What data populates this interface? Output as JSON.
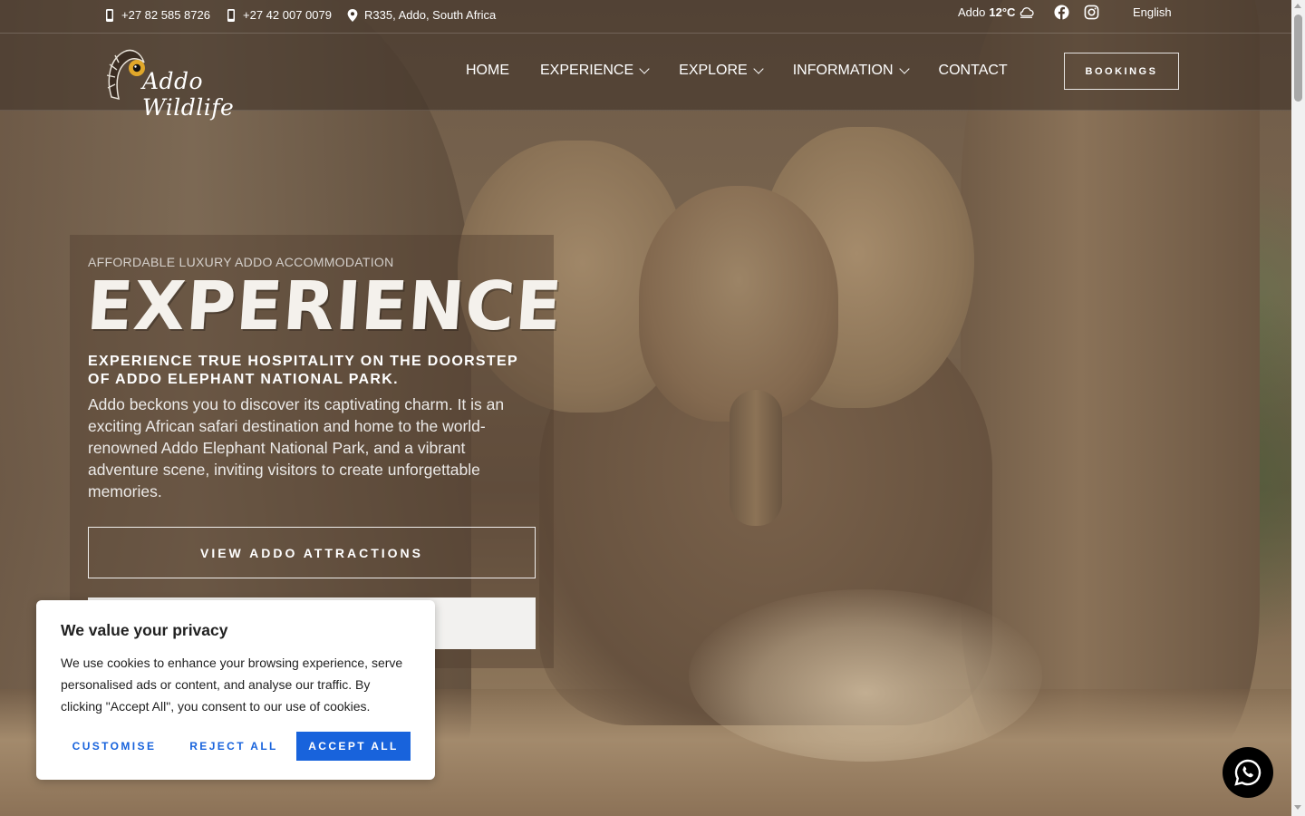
{
  "topbar": {
    "phone1": "+27 82 585 8726",
    "phone2": "+27 42 007 0079",
    "address": "R335, Addo, South Africa",
    "weather_place": "Addo",
    "weather_temp": "12°C",
    "language": "English"
  },
  "header": {
    "logo_text": "Addo Wildlife",
    "nav": {
      "home": "HOME",
      "experience": "EXPERIENCE",
      "explore": "EXPLORE",
      "information": "INFORMATION",
      "contact": "CONTACT"
    },
    "bookings": "BOOKINGS"
  },
  "hero": {
    "eyebrow": "AFFORDABLE LUXURY ADDO ACCOMMODATION",
    "title": "EXPERIENCE",
    "subtitle": "EXPERIENCE TRUE HOSPITALITY ON THE DOORSTEP OF ADDO ELEPHANT NATIONAL PARK.",
    "body": "Addo beckons you to discover its captivating charm. It is an exciting African safari destination and home to the world-renowned Addo Elephant National Park, and a vibrant adventure scene, inviting visitors to create unforgettable memories.",
    "button": "VIEW ADDO ATTRACTIONS"
  },
  "cookie": {
    "title": "We value your privacy",
    "text": "We use cookies to enhance your browsing experience, serve personalised ads or content, and analyse our traffic. By clicking \"Accept All\", you consent to our use of cookies.",
    "customise": "CUSTOMISE",
    "reject": "REJECT ALL",
    "accept": "ACCEPT ALL"
  },
  "colors": {
    "accent": "#1863dc",
    "overlay": "#3c3026"
  },
  "icons": [
    "mobile-phone-icon",
    "map-pin-icon",
    "cloud-weather-icon",
    "facebook-icon",
    "instagram-icon",
    "whatsapp-icon",
    "chevron-down-icon"
  ]
}
